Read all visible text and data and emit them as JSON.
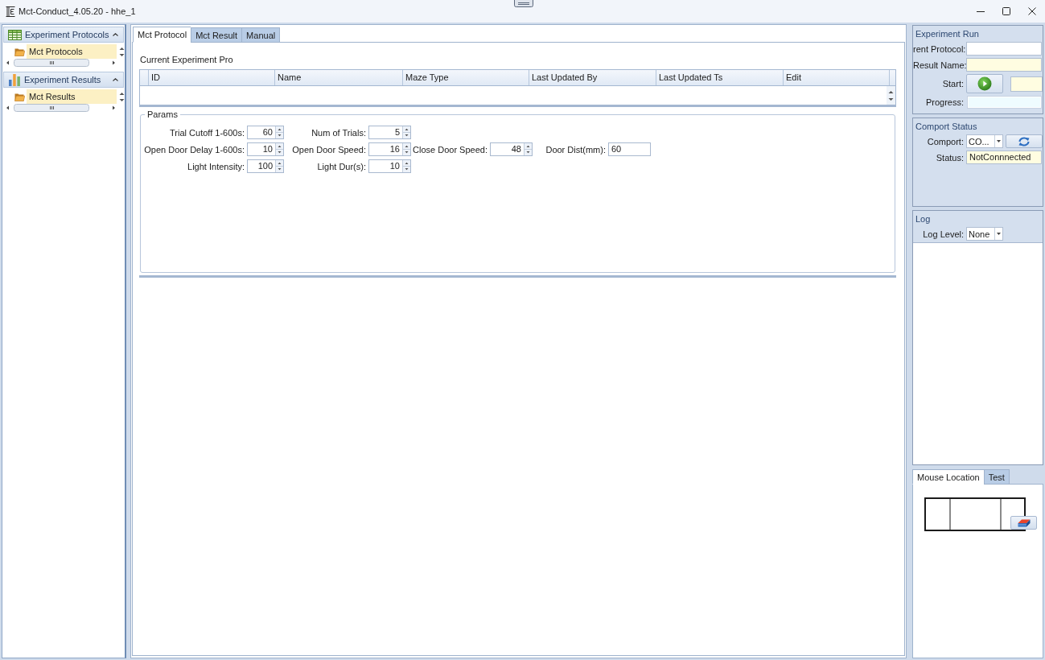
{
  "window": {
    "title": "Mct-Conduct_4.05.20 - hhe_1"
  },
  "navigation": {
    "groups": [
      {
        "title": "Experiment Protocols",
        "expanded": true,
        "items": [
          {
            "label": "Mct Protocols",
            "selected": true
          }
        ]
      },
      {
        "title": "Experiment Results",
        "expanded": true,
        "items": [
          {
            "label": "Mct Results",
            "selected": true
          }
        ]
      }
    ]
  },
  "tabs": [
    {
      "label": "Mct Protocol",
      "selected": true
    },
    {
      "label": "Mct Result",
      "selected": false
    },
    {
      "label": "Manual",
      "selected": false
    }
  ],
  "protocol_list": {
    "label": "Current Experiment Pro",
    "table": {
      "columns": [
        "ID",
        "Name",
        "Maze Type",
        "Last Updated By",
        "Last Updated Ts",
        "Edit"
      ]
    }
  },
  "params": {
    "title": "Params",
    "rows": [
      {
        "fields": [
          {
            "kind": "spinner",
            "label": "Trial Cutoff 1-600s:",
            "value": "60"
          },
          {
            "kind": "spinner",
            "label": "Num of Trials:",
            "value": "5"
          }
        ]
      },
      {
        "fields": [
          {
            "kind": "spinner",
            "label": "Open Door Delay 1-600s:",
            "value": "10"
          },
          {
            "kind": "spinner",
            "label": "Open Door Speed:",
            "value": "16"
          },
          {
            "kind": "spinner",
            "label": "Close Door Speed:",
            "value": "48"
          },
          {
            "kind": "text",
            "label": "Door Dist(mm):",
            "value": "60"
          }
        ]
      },
      {
        "fields": [
          {
            "kind": "spinner",
            "label": "Light Intensity:",
            "value": "100"
          },
          {
            "kind": "spinner",
            "label": "Light Dur(s):",
            "value": "10"
          }
        ]
      }
    ]
  },
  "experiment_run": {
    "title": "Experiment Run",
    "rows": [
      {
        "kind": "text",
        "label": "rent Protocol:",
        "read_only": false
      },
      {
        "kind": "text",
        "label": "Result Name:",
        "read_only": true
      },
      {
        "kind": "start",
        "label": "Start:",
        "read_only": true
      },
      {
        "kind": "progress",
        "label": "Progress:",
        "level": 0
      }
    ]
  },
  "comport_status": {
    "title": "Comport Status",
    "rows": [
      {
        "kind": "combo",
        "label": "Comport:",
        "value": "CO...",
        "refresh": true
      },
      {
        "kind": "text",
        "label": "Status:",
        "value": "NotConnnected",
        "read_only": true
      }
    ]
  },
  "log": {
    "title": "Log",
    "rows": [
      {
        "kind": "combo",
        "label": "Log Level:",
        "value": "None"
      }
    ]
  },
  "bottom_tabs": [
    {
      "label": "Mouse Location",
      "selected": true
    },
    {
      "label": "Test",
      "selected": false
    }
  ]
}
